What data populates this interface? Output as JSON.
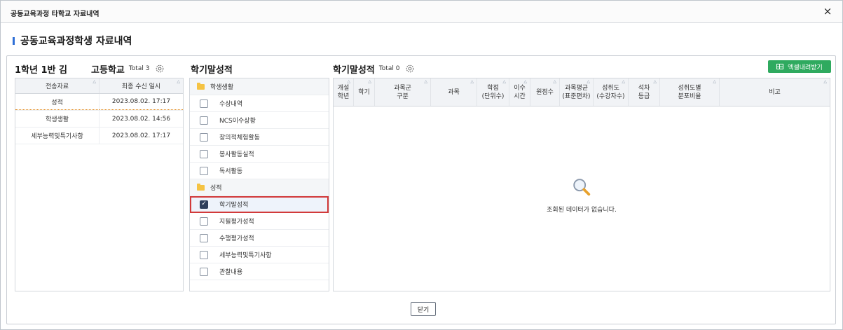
{
  "window": {
    "title": "공동교육과정 타학교 자료내역",
    "close_glyph": "×"
  },
  "section": {
    "title": "공동교육과정학생 자료내역"
  },
  "left": {
    "student": "1학년 1반 김",
    "school": "고등학교",
    "total": "Total 3",
    "columns": [
      "전송자료",
      "최종 수신 일시"
    ],
    "rows": [
      {
        "name": "성적",
        "date": "2023.08.02. 17:17"
      },
      {
        "name": "학생생활",
        "date": "2023.08.02. 14:56"
      },
      {
        "name": "세부능력및특기사항",
        "date": "2023.08.02. 17:17"
      }
    ]
  },
  "middle": {
    "title": "학기말성적",
    "groups": [
      {
        "label": "학생생활",
        "items": [
          {
            "label": "수상내역",
            "checked": false
          },
          {
            "label": "NCS이수상황",
            "checked": false
          },
          {
            "label": "창의적체험활동",
            "checked": false
          },
          {
            "label": "봉사활동실적",
            "checked": false
          },
          {
            "label": "독서활동",
            "checked": false
          }
        ]
      },
      {
        "label": "성적",
        "items": [
          {
            "label": "학기말성적",
            "checked": true
          },
          {
            "label": "지필평가성적",
            "checked": false
          },
          {
            "label": "수행평가성적",
            "checked": false
          },
          {
            "label": "세부능력및특기사항",
            "checked": false
          },
          {
            "label": "관찰내용",
            "checked": false
          }
        ]
      }
    ]
  },
  "right": {
    "title": "학기말성적",
    "total": "Total 0",
    "excel_label": "엑셀내려받기",
    "columns": [
      {
        "label": "개설\n학년"
      },
      {
        "label": "학기"
      },
      {
        "label": "과목군\n구분"
      },
      {
        "label": "과목"
      },
      {
        "label": "학점\n(단위수)"
      },
      {
        "label": "이수\n시간"
      },
      {
        "label": "원점수"
      },
      {
        "label": "과목평균\n(표준편차)"
      },
      {
        "label": "성취도\n(수강자수)"
      },
      {
        "label": "석차\n등급"
      },
      {
        "label": "성취도별\n분포비율"
      },
      {
        "label": "비고"
      }
    ],
    "empty_text": "조회된 데이터가 없습니다."
  },
  "footer": {
    "close_label": "닫기"
  },
  "colors": {
    "accent": "#2f6fd6",
    "excel": "#2faa5f",
    "selected_outline": "#d23a3a"
  }
}
